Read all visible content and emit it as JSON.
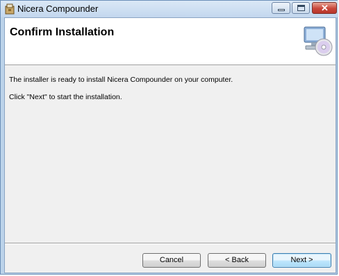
{
  "window": {
    "title": "Nicera Compounder",
    "controls": {
      "minimize": "minimize",
      "maximize": "maximize",
      "close": "✕"
    }
  },
  "header": {
    "title": "Confirm Installation"
  },
  "body": {
    "line1": "The installer is ready to install Nicera Compounder on your computer.",
    "line2": "Click \"Next\" to start the installation."
  },
  "buttons": {
    "cancel": "Cancel",
    "back": "< Back",
    "next": "Next >"
  },
  "icons": {
    "app": "installer-app-icon",
    "header": "computer-cd-icon"
  },
  "colors": {
    "titlebar": "#c3d7ee",
    "close_button": "#c8473a",
    "default_button": "#bee6fd"
  }
}
